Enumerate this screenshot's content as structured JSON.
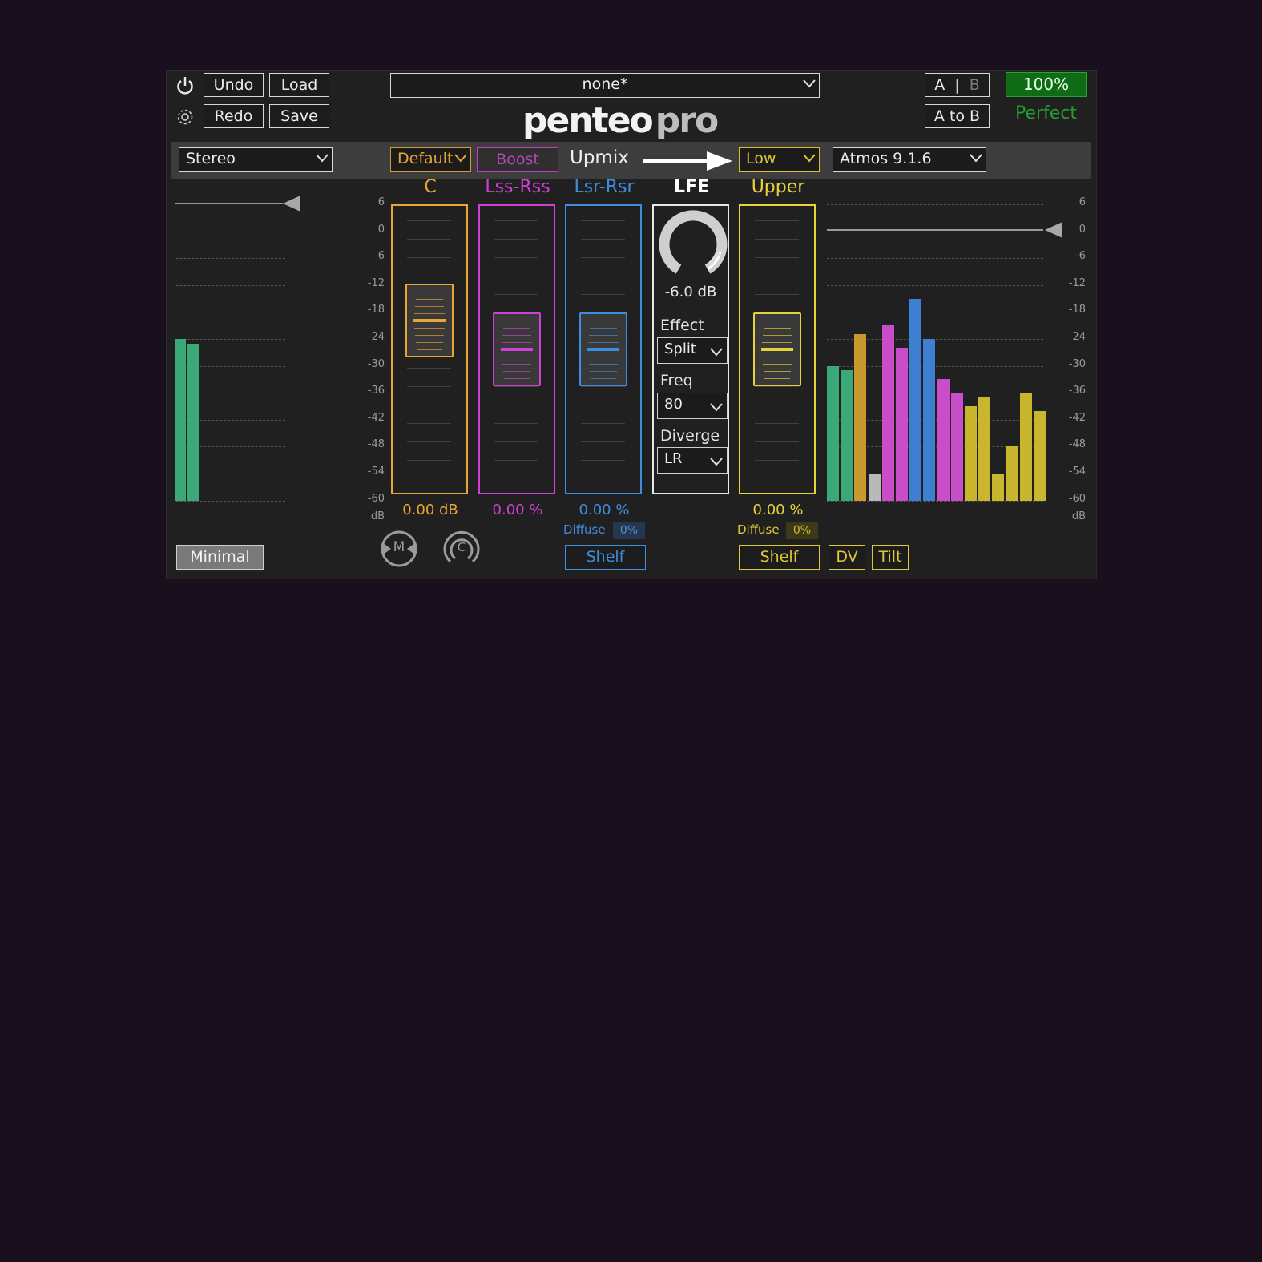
{
  "header": {
    "undo_label": "Undo",
    "redo_label": "Redo",
    "load_label": "Load",
    "save_label": "Save",
    "preset_value": "none*",
    "logo_text_left": "Penteo",
    "logo_text_right": "Pro",
    "ab_a": "A",
    "ab_sep": "|",
    "ab_b": "B",
    "a_to_b_label": "A to B",
    "quality_percent": "100%",
    "quality_label": "Perfect"
  },
  "toolbar": {
    "input_format": "Stereo",
    "style_value": "Default",
    "boost_label": "Boost",
    "upmix_label": "Upmix",
    "lfe_mode": "Low",
    "output_format": "Atmos 9.1.6"
  },
  "scale": {
    "ticks": [
      "6",
      "0",
      "-6",
      "-12",
      "-18",
      "-24",
      "-30",
      "-36",
      "-42",
      "-48",
      "-54",
      "-60"
    ],
    "unit": "dB"
  },
  "channels": {
    "c": {
      "label": "C",
      "value": "0.00 dB",
      "color": "#e9a632",
      "fader_level": 0.0
    },
    "lss": {
      "label": "Lss-Rss",
      "value": "0.00 %",
      "color": "#d23fd6",
      "fader_level": 0.0
    },
    "lsr": {
      "label": "Lsr-Rsr",
      "value": "0.00 %",
      "color": "#3e8ee0",
      "fader_level": 0.0,
      "diffuse_label": "Diffuse",
      "diffuse_value": "0%",
      "shelf_label": "Shelf"
    },
    "lfe": {
      "label": "LFE",
      "knob_value": "-6.0 dB",
      "effect_label": "Effect",
      "effect_value": "Split",
      "freq_label": "Freq",
      "freq_value": "80",
      "diverge_label": "Diverge",
      "diverge_value": "LR"
    },
    "upper": {
      "label": "Upper",
      "value": "0.00 %",
      "color": "#e8d23a",
      "fader_level": 0.0,
      "diffuse_label": "Diffuse",
      "diffuse_value": "0%",
      "shelf_label": "Shelf"
    }
  },
  "footer": {
    "minimal_label": "Minimal",
    "m_label": "M",
    "c_label": "C",
    "dv_label": "DV",
    "tilt_label": "Tilt"
  },
  "input_meters": [
    {
      "level_db": -24,
      "color": "#3aa877"
    },
    {
      "level_db": -25,
      "color": "#3aa877"
    }
  ],
  "output_meters": [
    {
      "level_db": -30,
      "color": "#3aa877"
    },
    {
      "level_db": -31,
      "color": "#3aa877"
    },
    {
      "level_db": -23,
      "color": "#c79a2e"
    },
    {
      "level_db": -54,
      "color": "#b9b9b9"
    },
    {
      "level_db": -21,
      "color": "#c94cc9"
    },
    {
      "level_db": -26,
      "color": "#c94cc9"
    },
    {
      "level_db": -15,
      "color": "#3f7fd2"
    },
    {
      "level_db": -24,
      "color": "#3f7fd2"
    },
    {
      "level_db": -33,
      "color": "#c94cc9"
    },
    {
      "level_db": -36,
      "color": "#c94cc9"
    },
    {
      "level_db": -39,
      "color": "#c9b52e"
    },
    {
      "level_db": -37,
      "color": "#c9b52e"
    },
    {
      "level_db": -54,
      "color": "#c9b52e"
    },
    {
      "level_db": -48,
      "color": "#c9b52e"
    },
    {
      "level_db": -36,
      "color": "#c9b52e"
    },
    {
      "level_db": -40,
      "color": "#c9b52e"
    }
  ]
}
